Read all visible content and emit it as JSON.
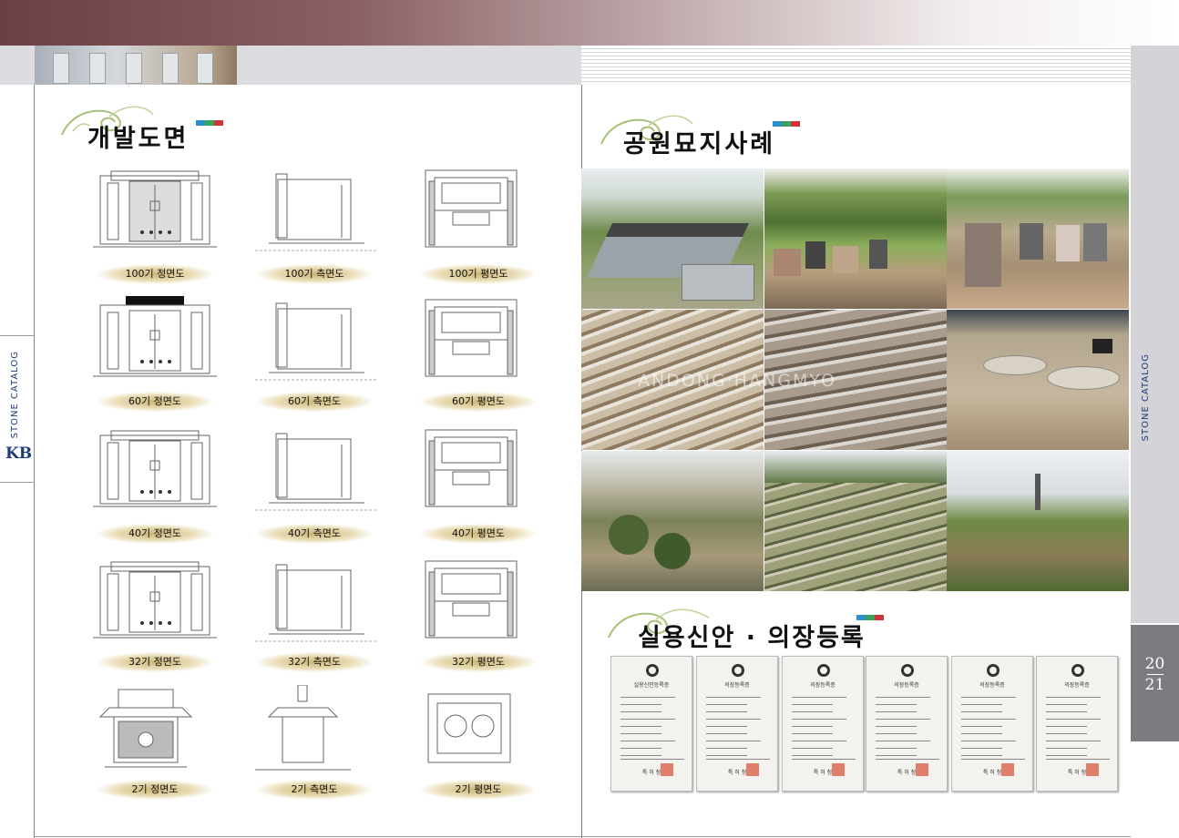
{
  "spine": {
    "left": "STONE CATALOG",
    "right": "STONE CATALOG",
    "logo": "KB"
  },
  "page_numbers": {
    "left": "20",
    "right": "21"
  },
  "left_section": {
    "title": "개발도면",
    "drawings": [
      {
        "caption": "100기 정면도"
      },
      {
        "caption": "100기 측면도"
      },
      {
        "caption": "100기 평면도"
      },
      {
        "caption": "60기 정면도"
      },
      {
        "caption": "60기 측면도"
      },
      {
        "caption": "60기 평면도"
      },
      {
        "caption": "40기 정면도"
      },
      {
        "caption": "40기 측면도"
      },
      {
        "caption": "40기 평면도"
      },
      {
        "caption": "32기 정면도"
      },
      {
        "caption": "32기 측면도"
      },
      {
        "caption": "32기 평면도"
      },
      {
        "caption": "2기 정면도"
      },
      {
        "caption": "2기 측면도"
      },
      {
        "caption": "2기 평면도"
      }
    ]
  },
  "right_section": {
    "title": "공원묘지사례",
    "watermark": "ANDONG·HANGMYO",
    "certs_title": "실용신안 · 의장등록",
    "certificates": [
      {
        "title": "실용신안등록증"
      },
      {
        "title": "의장등록증"
      },
      {
        "title": "의장등록증"
      },
      {
        "title": "의장등록증"
      },
      {
        "title": "의장등록증"
      },
      {
        "title": "의장등록증"
      }
    ],
    "cert_footer": "특 허 청"
  },
  "colors": {
    "accent_blue": "#1f3b78",
    "bar_blue": "#2a8fd0",
    "bar_green": "#3aa35a",
    "bar_red": "#d0343a"
  }
}
